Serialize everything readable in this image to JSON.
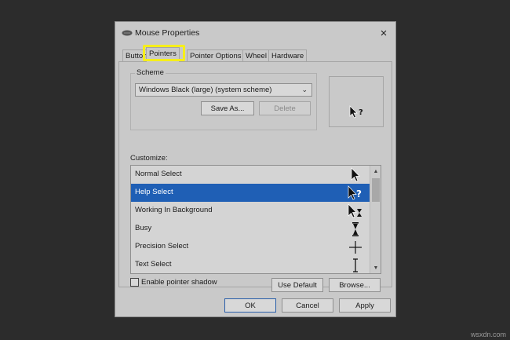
{
  "window": {
    "title": "Mouse Properties",
    "close_label": "×"
  },
  "tabs": [
    {
      "label": "Buttons",
      "active": false
    },
    {
      "label": "Pointers",
      "active": true
    },
    {
      "label": "Pointer Options",
      "active": false
    },
    {
      "label": "Wheel",
      "active": false
    },
    {
      "label": "Hardware",
      "active": false
    }
  ],
  "scheme": {
    "group_label": "Scheme",
    "selected": "Windows Black (large) (system scheme)",
    "save_as_label": "Save As...",
    "delete_label": "Delete"
  },
  "customize": {
    "label": "Customize:",
    "items": [
      {
        "label": "Normal Select",
        "cursor_icon": "arrow-cursor-icon",
        "selected": false
      },
      {
        "label": "Help Select",
        "cursor_icon": "help-cursor-icon",
        "selected": true
      },
      {
        "label": "Working In Background",
        "cursor_icon": "working-cursor-icon",
        "selected": false
      },
      {
        "label": "Busy",
        "cursor_icon": "hourglass-cursor-icon",
        "selected": false
      },
      {
        "label": "Precision Select",
        "cursor_icon": "crosshair-cursor-icon",
        "selected": false
      },
      {
        "label": "Text Select",
        "cursor_icon": "text-beam-cursor-icon",
        "selected": false
      }
    ]
  },
  "options": {
    "pointer_shadow_label": "Enable pointer shadow",
    "pointer_shadow_checked": false,
    "use_default_label": "Use Default",
    "browse_label": "Browse..."
  },
  "footer": {
    "ok_label": "OK",
    "cancel_label": "Cancel",
    "apply_label": "Apply"
  },
  "watermark": "wsxdn.com",
  "colors": {
    "highlight": "#f6ee1a",
    "selection": "#1f5fb5",
    "dialog_bg": "#c9c9c9",
    "backdrop": "#2c2c2c"
  }
}
